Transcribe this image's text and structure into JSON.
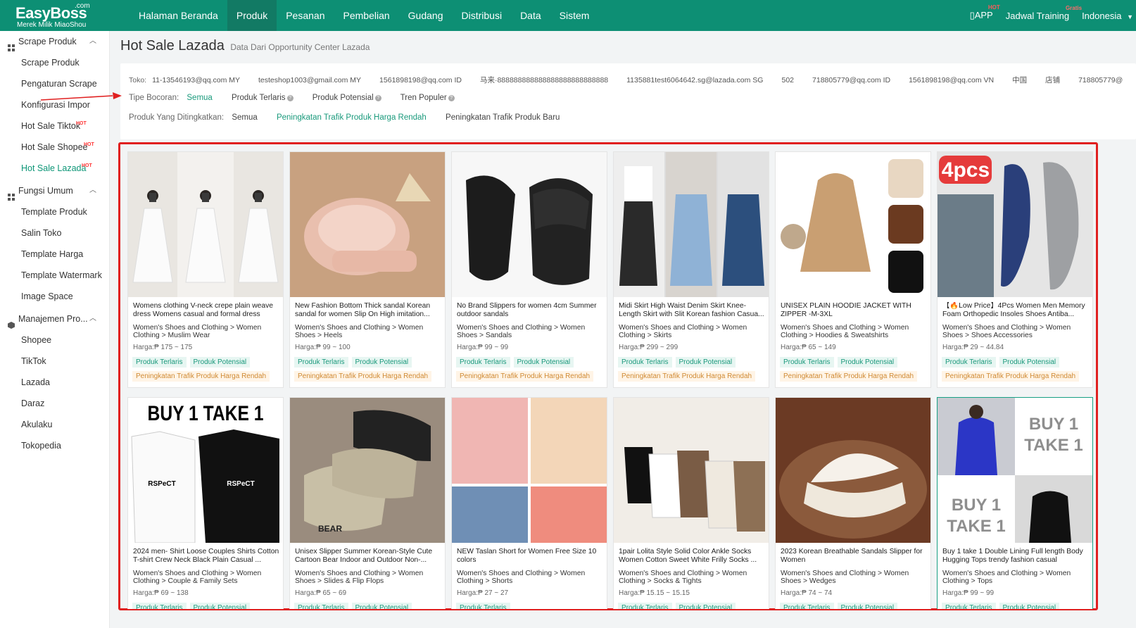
{
  "brand": {
    "name": "EasyBoss",
    "domain": ".com",
    "tagline": "Merek Milik MiaoShou"
  },
  "nav": {
    "items": [
      "Halaman Beranda",
      "Produk",
      "Pesanan",
      "Pembelian",
      "Gudang",
      "Distribusi",
      "Data",
      "Sistem"
    ],
    "active": "Produk"
  },
  "right_nav": {
    "app": "APP",
    "app_badge": "HOT",
    "training": "Jadwal Training",
    "training_badge": "Gratis",
    "language": "Indonesia"
  },
  "sidebar": {
    "groups": [
      {
        "label": "Scrape Produk",
        "items": [
          {
            "label": "Scrape Produk"
          },
          {
            "label": "Pengaturan Scrape"
          },
          {
            "label": "Konfigurasi Impor"
          },
          {
            "label": "Hot Sale Tiktok",
            "badge": "HOT"
          },
          {
            "label": "Hot Sale Shopee",
            "badge": "HOT"
          },
          {
            "label": "Hot Sale Lazada",
            "badge": "HOT",
            "active": true
          }
        ]
      },
      {
        "label": "Fungsi Umum",
        "items": [
          {
            "label": "Template Produk"
          },
          {
            "label": "Salin Toko"
          },
          {
            "label": "Template Harga"
          },
          {
            "label": "Template Watermark"
          },
          {
            "label": "Image Space"
          }
        ]
      },
      {
        "label": "Manajemen Pro...",
        "items": [
          {
            "label": "Shopee"
          },
          {
            "label": "TikTok"
          },
          {
            "label": "Lazada"
          },
          {
            "label": "Daraz"
          },
          {
            "label": "Akulaku"
          },
          {
            "label": "Tokopedia"
          }
        ]
      }
    ]
  },
  "page": {
    "title": "Hot Sale Lazada",
    "subtitle": "Data Dari Opportunity Center Lazada"
  },
  "filters": {
    "shop_label": "Toko:",
    "shops": [
      "11-13546193@qq.com MY",
      "testeshop1003@gmail.com MY",
      "1561898198@qq.com ID",
      "马来·888888888888888888888888888",
      "1135881test6064642.sg@lazada.com SG",
      "502",
      "718805779@qq.com ID",
      "1561898198@qq.com VN",
      "中国",
      "店铺",
      "718805779@"
    ],
    "leak_label": "Tipe Bocoran:",
    "leak_options": [
      "Semua",
      "Produk Terlaris",
      "Produk Potensial",
      "Tren Populer"
    ],
    "improved_label": "Produk Yang Ditingkatkan:",
    "improved_options": [
      "Semua",
      "Peningkatan Trafik Produk Harga Rendah",
      "Peningkatan Trafik Produk Baru"
    ]
  },
  "products": [
    {
      "title": "Womens clothing V-neck crepe plain weave dress Womens casual and formal dress",
      "category": "Women's Shoes and Clothing > Women Clothing > Muslim Wear",
      "price": "Harga:₱ 175 ~ 175",
      "tags": [
        "Produk Terlaris",
        "Produk Potensial"
      ],
      "boost": "Peningkatan Trafik Produk Harga Rendah"
    },
    {
      "title": "New Fashion Bottom Thick sandal Korean sandal for women Slip On High imitation...",
      "category": "Women's Shoes and Clothing > Women Shoes > Heels",
      "price": "Harga:₱ 99 ~ 100",
      "tags": [
        "Produk Terlaris",
        "Produk Potensial"
      ],
      "boost": "Peningkatan Trafik Produk Harga Rendah"
    },
    {
      "title": "No Brand Slippers for women 4cm Summer outdoor sandals",
      "category": "Women's Shoes and Clothing > Women Shoes > Sandals",
      "price": "Harga:₱ 99 ~ 99",
      "tags": [
        "Produk Terlaris",
        "Produk Potensial"
      ],
      "boost": "Peningkatan Trafik Produk Harga Rendah"
    },
    {
      "title": "Midi Skirt High Waist Denim Skirt Knee-Length Skirt with Slit Korean fashion Casua...",
      "category": "Women's Shoes and Clothing > Women Clothing > Skirts",
      "price": "Harga:₱ 299 ~ 299",
      "tags": [
        "Produk Terlaris",
        "Produk Potensial"
      ],
      "boost": "Peningkatan Trafik Produk Harga Rendah"
    },
    {
      "title": "UNISEX PLAIN HOODIE JACKET WITH ZIPPER -M-3XL",
      "category": "Women's Shoes and Clothing > Women Clothing > Hoodies & Sweatshirts",
      "price": "Harga:₱ 65 ~ 149",
      "tags": [
        "Produk Terlaris",
        "Produk Potensial"
      ],
      "boost": "Peningkatan Trafik Produk Harga Rendah"
    },
    {
      "title": "【🔥Low Price】4Pcs Women Men Memory Foam Orthopedic Insoles Shoes Antiba...",
      "category": "Women's Shoes and Clothing > Women Shoes > Shoes Accessories",
      "price": "Harga:₱ 29 ~ 44.84",
      "tags": [
        "Produk Terlaris",
        "Produk Potensial"
      ],
      "boost": "Peningkatan Trafik Produk Harga Rendah",
      "img_text": "4pcs"
    },
    {
      "title": "2024 men- Shirt Loose Couples Shirts Cotton T-shirt Crew Neck Black Plain Casual ...",
      "category": "Women's Shoes and Clothing > Women Clothing > Couple & Family Sets",
      "price": "Harga:₱ 69 ~ 138",
      "tags": [
        "Produk Terlaris",
        "Produk Potensial"
      ],
      "img_text": "BUY 1 TAKE 1",
      "print_text": "RSPeCT"
    },
    {
      "title": "Unisex Slipper Summer Korean-Style Cute Cartoon Bear Indoor and Outdoor Non-...",
      "category": "Women's Shoes and Clothing > Women Shoes > Slides & Flip Flops",
      "price": "Harga:₱ 65 ~ 69",
      "tags": [
        "Produk Terlaris",
        "Produk Potensial"
      ],
      "img_text": "BEAR"
    },
    {
      "title": "NEW Taslan Short for Women Free Size 10 colors",
      "category": "Women's Shoes and Clothing > Women Clothing > Shorts",
      "price": "Harga:₱ 27 ~ 27",
      "tags": [
        "Produk Terlaris"
      ]
    },
    {
      "title": "1pair Lolita Style Solid Color Ankle Socks Women Cotton Sweet White Frilly Socks ...",
      "category": "Women's Shoes and Clothing > Women Clothing > Socks & Tights",
      "price": "Harga:₱ 15.15 ~ 15.15",
      "tags": [
        "Produk Terlaris",
        "Produk Potensial"
      ]
    },
    {
      "title": "2023 Korean Breathable Sandals Slipper for Women",
      "category": "Women's Shoes and Clothing > Women Shoes > Wedges",
      "price": "Harga:₱ 74 ~ 74",
      "tags": [
        "Produk Terlaris",
        "Produk Potensial"
      ]
    },
    {
      "title": "Buy 1 take 1 Double Lining Full length Body Hugging Tops trendy fashion casual",
      "category": "Women's Shoes and Clothing > Women Clothing > Tops",
      "price": "Harga:₱ 99 ~ 99",
      "tags": [
        "Produk Terlaris",
        "Produk Potensial"
      ],
      "img_text": "BUY 1 TAKE 1"
    }
  ]
}
